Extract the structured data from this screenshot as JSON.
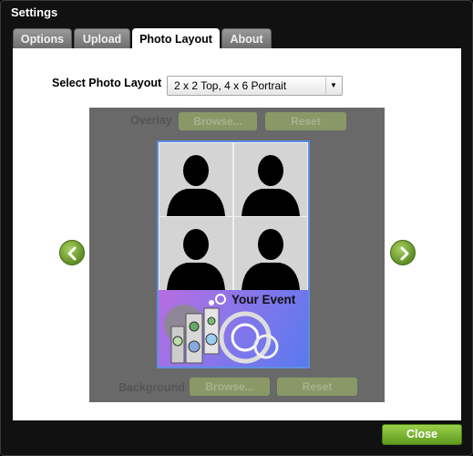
{
  "window": {
    "title": "Settings"
  },
  "tabs": [
    {
      "label": "Options"
    },
    {
      "label": "Upload"
    },
    {
      "label": "Photo Layout"
    },
    {
      "label": "About"
    }
  ],
  "photo_layout": {
    "select_label": "Select Photo Layout",
    "selected_layout": "2 x 2 Top, 4 x 6 Portrait",
    "overlay_label": "Overlay",
    "background_label": "Background",
    "browse_label": "Browse...",
    "reset_label": "Reset",
    "event_text": "Your Event"
  },
  "footer": {
    "close_label": "Close"
  }
}
